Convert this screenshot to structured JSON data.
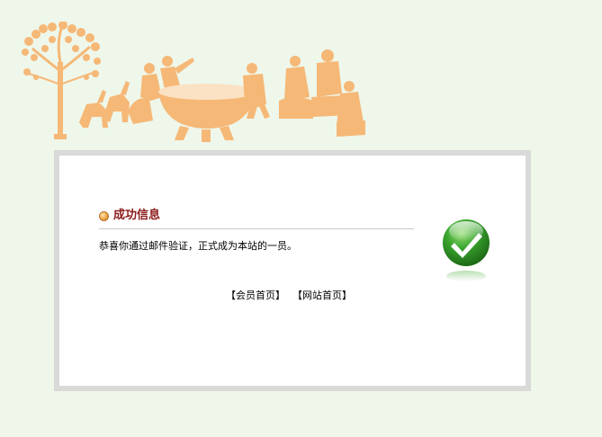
{
  "banner": {
    "illustration": "orange-papercut-banner-tree-people-and-large-bowl"
  },
  "panel": {
    "title": "成功信息",
    "message": "恭喜你通过邮件验证，正式成为本站的一员。",
    "links": {
      "member_home": "【会员首页】",
      "site_home": "【网站首页】"
    },
    "status_icon": "green-checkmark-icon"
  },
  "colors": {
    "background": "#eef7ea",
    "title": "#8b1a1a",
    "banner_orange": "#f6b877",
    "check_green": "#3aa52e"
  }
}
